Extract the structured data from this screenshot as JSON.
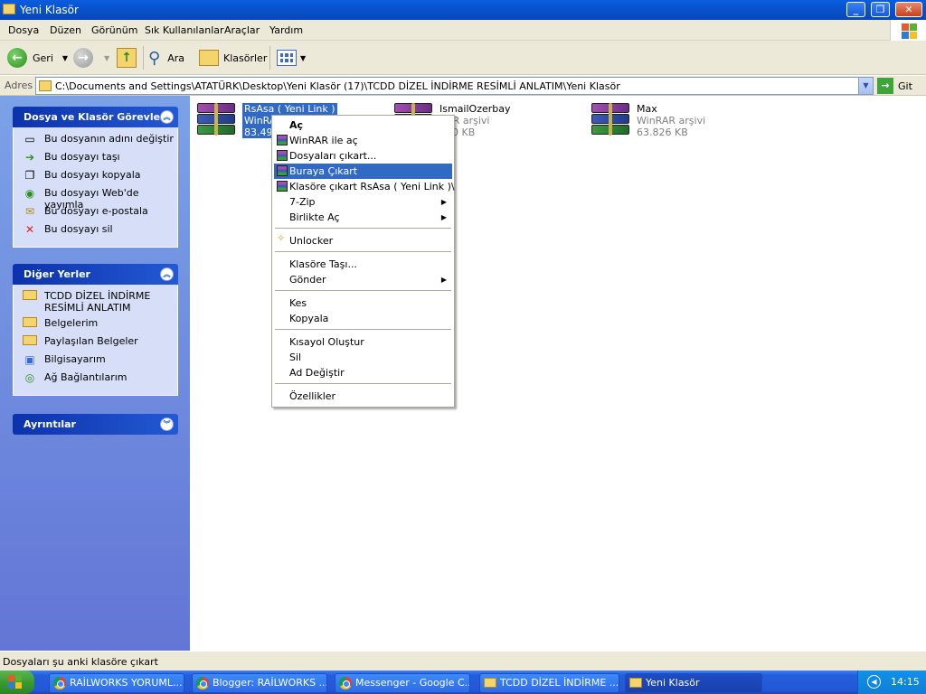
{
  "window": {
    "title": "Yeni Klasör",
    "minimize": "_",
    "maximize": "❐",
    "close": "✕"
  },
  "menubar": {
    "items": [
      "Dosya",
      "Düzen",
      "Görünüm",
      "Sık Kullanılanlar",
      "Araçlar",
      "Yardım"
    ]
  },
  "toolbar": {
    "back": "Geri",
    "search": "Ara",
    "folders": "Klasörler"
  },
  "address": {
    "label": "Adres",
    "path": "C:\\Documents and Settings\\ATATÜRK\\Desktop\\Yeni Klasör (17)\\TCDD DİZEL İNDİRME RESİMLİ ANLATIM\\Yeni Klasör",
    "go": "Git"
  },
  "sidebar": {
    "tasks": {
      "title": "Dosya ve Klasör Görevleri",
      "items": [
        "Bu dosyanın adını değiştir",
        "Bu dosyayı taşı",
        "Bu dosyayı kopyala",
        "Bu dosyayı Web'de yayımla",
        "Bu dosyayı e-postala",
        "Bu dosyayı sil"
      ]
    },
    "other_places": {
      "title": "Diğer Yerler",
      "items": [
        "TCDD DİZEL İNDİRME RESİMLİ ANLATIM",
        "Belgelerim",
        "Paylaşılan Belgeler",
        "Bilgisayarım",
        "Ağ Bağlantılarım"
      ]
    },
    "details": {
      "title": "Ayrıntılar"
    }
  },
  "files": [
    {
      "name": "RsAsa ( Yeni Link )",
      "type": "WinRAR arşivi",
      "size": "83.495 KB",
      "type_visible": "WinRA",
      "size_visible": "83.495"
    },
    {
      "name": "IsmailOzerbay",
      "type": "WinRAR arşivi",
      "size": "190 KB",
      "type_visible": "RAR arşivi",
      "size_visible": "190 KB"
    },
    {
      "name": "Max",
      "type": "WinRAR arşivi",
      "size": "63.826 KB"
    }
  ],
  "context_menu": {
    "open": "Aç",
    "winrar_open": "WinRAR ile aç",
    "extract_files": "Dosyaları çıkart...",
    "extract_here": "Buraya Çıkart",
    "extract_to": "Klasöre çıkart RsAsa ( Yeni Link )\\",
    "sevenzip": "7-Zip",
    "open_with": "Birlikte Aç",
    "unlocker": "Unlocker",
    "move_to": "Klasöre Taşı...",
    "send_to": "Gönder",
    "cut": "Kes",
    "copy": "Kopyala",
    "shortcut": "Kısayol Oluştur",
    "delete": "Sil",
    "rename": "Ad Değiştir",
    "properties": "Özellikler"
  },
  "status": {
    "text": "Dosyaları şu anki klasöre çıkart"
  },
  "taskbar": {
    "tasks": [
      "RAİLWORKS YORUML...",
      "Blogger: RAİLWORKS ...",
      "Messenger - Google C...",
      "TCDD DİZEL İNDİRME ...",
      "Yeni Klasör"
    ],
    "clock": "14:15"
  },
  "colors": {
    "selection": "#316ac5",
    "titlebar": "#0851cc",
    "sidebar": "#6f8fe0",
    "taskbar": "#245edb"
  }
}
